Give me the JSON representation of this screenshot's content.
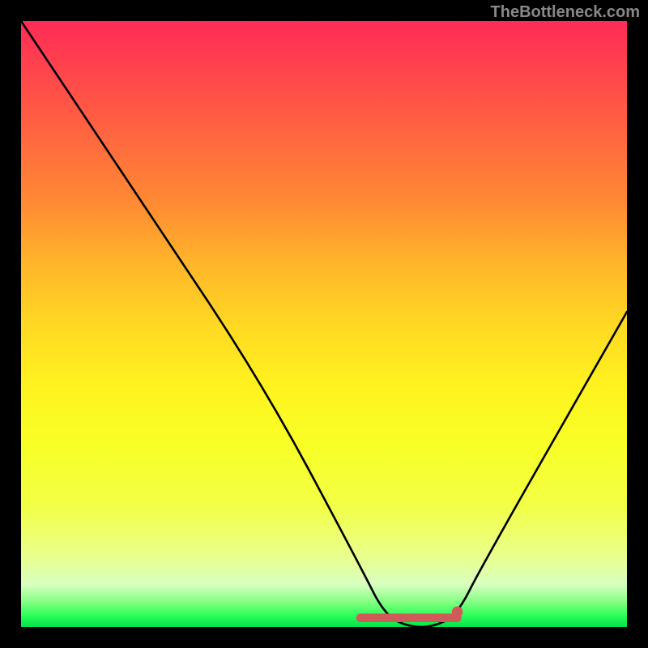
{
  "watermark": "TheBottleneck.com",
  "chart_data": {
    "type": "line",
    "title": "",
    "xlabel": "",
    "ylabel": "",
    "xlim": [
      0,
      100
    ],
    "ylim": [
      0,
      100
    ],
    "series": [
      {
        "name": "bottleneck-curve",
        "x": [
          0,
          20,
          40,
          56,
          60,
          64,
          68,
          72,
          76,
          100
        ],
        "values": [
          100,
          70,
          40,
          10,
          2,
          0,
          0,
          2,
          10,
          52
        ]
      }
    ],
    "annotations": [
      {
        "name": "flat-highlight",
        "xrange": [
          56,
          72
        ],
        "y": 1.5,
        "color": "#d05a5a"
      },
      {
        "name": "dot-marker",
        "x": 72,
        "y": 2.5,
        "color": "#d05a5a"
      }
    ],
    "background_gradient": {
      "direction": "vertical",
      "stops": [
        {
          "pos": 0,
          "color": "#ff2b57"
        },
        {
          "pos": 50,
          "color": "#ffd823"
        },
        {
          "pos": 100,
          "color": "#00e34a"
        }
      ]
    }
  }
}
